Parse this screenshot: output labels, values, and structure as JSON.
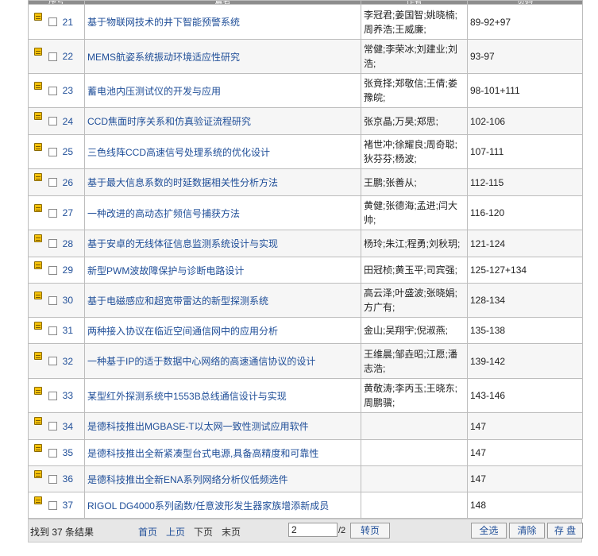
{
  "header": {
    "col_seq": "序号",
    "col_title": "篇名",
    "col_author": "作者",
    "col_pages": "页码"
  },
  "rows": [
    {
      "num": "21",
      "title": "基于物联网技术的井下智能预警系统",
      "authors": "李冠君;姜国智;姚晓楠;周养浩;王威廉;",
      "pages": "89-92+97"
    },
    {
      "num": "22",
      "title": "MEMS航姿系统振动环境适应性研究",
      "authors": "常健;李荣冰;刘建业;刘浩;",
      "pages": "93-97"
    },
    {
      "num": "23",
      "title": "蓄电池内压测试仪的开发与应用",
      "authors": "张竟择;郑敬信;王倩;娄豫皖;",
      "pages": "98-101+111"
    },
    {
      "num": "24",
      "title": "CCD焦面时序关系和仿真验证流程研究",
      "authors": "张京晶;万昊;郑思;",
      "pages": "102-106"
    },
    {
      "num": "25",
      "title": "三色线阵CCD高速信号处理系统的优化设计",
      "authors": "褚世冲;徐耀良;周奇聪;狄芬芬;杨波;",
      "pages": "107-111"
    },
    {
      "num": "26",
      "title": "基于最大信息系数的时延数据相关性分析方法",
      "authors": "王鹏;张善从;",
      "pages": "112-115"
    },
    {
      "num": "27",
      "title": "一种改进的高动态扩频信号捕获方法",
      "authors": "黄健;张德海;孟进;闫大帅;",
      "pages": "116-120"
    },
    {
      "num": "28",
      "title": "基于安卓的无线体征信息监测系统设计与实现",
      "authors": "杨玲;朱江;程勇;刘秋玥;",
      "pages": "121-124"
    },
    {
      "num": "29",
      "title": "新型PWM波故障保护与诊断电路设计",
      "authors": "田冠桢;黄玉平;司宾强;",
      "pages": "125-127+134"
    },
    {
      "num": "30",
      "title": "基于电磁感应和超宽带雷达的新型探测系统",
      "authors": "高云泽;叶盛波;张晓娟;方广有;",
      "pages": "128-134"
    },
    {
      "num": "31",
      "title": "两种接入协议在临近空间通信网中的应用分析",
      "authors": "金山;吴翔宇;倪淑燕;",
      "pages": "135-138"
    },
    {
      "num": "32",
      "title": "一种基于IP的适于数据中心网络的高速通信协议的设计",
      "authors": "王维晨;邹垚昭;江愿;潘志浩;",
      "pages": "139-142"
    },
    {
      "num": "33",
      "title": "某型红外探测系统中1553B总线通信设计与实现",
      "authors": "黄敬涛;李丙玉;王晓东;周鹏骥;",
      "pages": "143-146"
    },
    {
      "num": "34",
      "title": "是德科技推出MGBASE-T以太网一致性测试应用软件",
      "authors": "",
      "pages": "147"
    },
    {
      "num": "35",
      "title": "是德科技推出全新紧凑型台式电源,具备高精度和可靠性",
      "authors": "",
      "pages": "147"
    },
    {
      "num": "36",
      "title": "是德科技推出全新ENA系列网络分析仪低频选件",
      "authors": "",
      "pages": "147"
    },
    {
      "num": "37",
      "title": "RIGOL DG4000系列函数/任意波形发生器家族增添新成员",
      "authors": "",
      "pages": "148"
    }
  ],
  "footer": {
    "found_text": "找到 37 条结果",
    "first": "首页",
    "prev": "上页",
    "next": "下页",
    "last": "末页",
    "page_value": "2",
    "page_total": "/2",
    "go": "转页",
    "select_all": "全选",
    "clear": "清除",
    "save": "存 盘"
  },
  "icons": {
    "row_icon": "document-icon"
  },
  "colors": {
    "link": "#1f4e98",
    "header_bg": "#8d8d8d",
    "footer_bg": "#e7e7e7",
    "icon": "#f5c20a"
  }
}
